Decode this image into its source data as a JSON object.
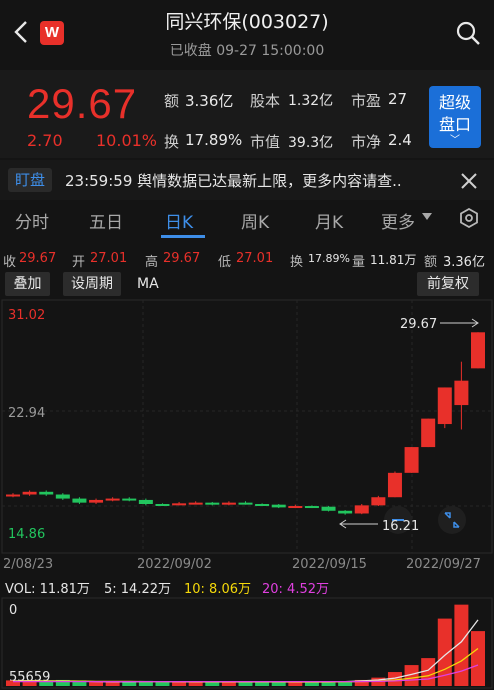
{
  "header": {
    "title": "同兴环保(003027)",
    "subtitle": "已收盘 09-27 15:00:00",
    "logo_text": "W"
  },
  "quote": {
    "price": "29.67",
    "change": "2.70",
    "change_pct": "10.01%",
    "amount_label": "额",
    "amount": "3.36亿",
    "equity_label": "股本",
    "equity": "1.32亿",
    "pe_label": "市盈",
    "pe": "27",
    "turnover_label": "换",
    "turnover": "17.89%",
    "mktcap_label": "市值",
    "mktcap": "39.3亿",
    "pb_label": "市净",
    "pb": "2.4",
    "super_btn_line1": "超级",
    "super_btn_line2": "盘口"
  },
  "alert": {
    "badge": "盯盘",
    "text": "23:59:59 舆情数据已达最新上限，更多内容请查.."
  },
  "tabs": [
    "分时",
    "五日",
    "日K",
    "周K",
    "月K",
    "更多"
  ],
  "active_tab": "日K",
  "ohlc": {
    "close_label": "收",
    "close": "29.67",
    "open_label": "开",
    "open": "27.01",
    "high_label": "高",
    "high": "29.67",
    "low_label": "低",
    "low": "27.01",
    "turnover_label": "换",
    "turnover": "17.89%",
    "volume_label": "量",
    "volume": "11.81万",
    "amount_label": "额",
    "amount": "3.36亿"
  },
  "controls": {
    "overlay": "叠加",
    "period": "设周期",
    "ma": "MA",
    "adjust": "前复权"
  },
  "colors": {
    "up": "#e8302a",
    "down": "#22c55e",
    "accent": "#3e8ee8",
    "ma10": "#f5d90a",
    "ma20": "#e040e0"
  },
  "chart_data": {
    "type": "candlestick",
    "price_axis": {
      "top_label": "31.02",
      "mid_label": "22.94",
      "bottom_label": "14.86",
      "ylim": [
        14.86,
        31.02
      ]
    },
    "x_labels": [
      "2/08/23",
      "2022/09/02",
      "2022/09/15",
      "2022/09/27"
    ],
    "annotations": {
      "max": "29.67",
      "min": "16.21"
    },
    "candles": [
      {
        "o": 17.6,
        "c": 17.7,
        "h": 17.8,
        "l": 17.5
      },
      {
        "o": 17.7,
        "c": 17.9,
        "h": 18.0,
        "l": 17.6
      },
      {
        "o": 17.9,
        "c": 17.7,
        "h": 18.0,
        "l": 17.6
      },
      {
        "o": 17.7,
        "c": 17.4,
        "h": 17.8,
        "l": 17.3
      },
      {
        "o": 17.4,
        "c": 17.1,
        "h": 17.5,
        "l": 17.0
      },
      {
        "o": 17.1,
        "c": 17.3,
        "h": 17.4,
        "l": 17.0
      },
      {
        "o": 17.3,
        "c": 17.4,
        "h": 17.5,
        "l": 17.2
      },
      {
        "o": 17.4,
        "c": 17.3,
        "h": 17.5,
        "l": 17.2
      },
      {
        "o": 17.3,
        "c": 17.0,
        "h": 17.4,
        "l": 16.9
      },
      {
        "o": 17.0,
        "c": 16.95,
        "h": 17.05,
        "l": 16.9
      },
      {
        "o": 16.95,
        "c": 17.05,
        "h": 17.15,
        "l": 16.9
      },
      {
        "o": 17.05,
        "c": 17.1,
        "h": 17.2,
        "l": 17.0
      },
      {
        "o": 17.1,
        "c": 16.95,
        "h": 17.15,
        "l": 16.9
      },
      {
        "o": 16.95,
        "c": 17.1,
        "h": 17.2,
        "l": 16.9
      },
      {
        "o": 17.1,
        "c": 17.0,
        "h": 17.2,
        "l": 16.95
      },
      {
        "o": 17.0,
        "c": 16.95,
        "h": 17.05,
        "l": 16.9
      },
      {
        "o": 16.95,
        "c": 16.75,
        "h": 17.0,
        "l": 16.7
      },
      {
        "o": 16.75,
        "c": 16.85,
        "h": 16.95,
        "l": 16.7
      },
      {
        "o": 16.85,
        "c": 16.75,
        "h": 16.9,
        "l": 16.7
      },
      {
        "o": 16.8,
        "c": 16.5,
        "h": 16.85,
        "l": 16.45
      },
      {
        "o": 16.5,
        "c": 16.3,
        "h": 16.55,
        "l": 16.21
      },
      {
        "o": 16.3,
        "c": 16.9,
        "h": 17.0,
        "l": 16.25
      },
      {
        "o": 16.9,
        "c": 17.5,
        "h": 17.6,
        "l": 16.85
      },
      {
        "o": 17.5,
        "c": 19.3,
        "h": 19.4,
        "l": 17.5
      },
      {
        "o": 19.3,
        "c": 21.2,
        "h": 21.2,
        "l": 19.3
      },
      {
        "o": 21.2,
        "c": 23.3,
        "h": 23.3,
        "l": 21.2
      },
      {
        "o": 22.9,
        "c": 25.6,
        "h": 25.6,
        "l": 22.6
      },
      {
        "o": 24.3,
        "c": 26.1,
        "h": 27.5,
        "l": 22.5
      },
      {
        "o": 27.01,
        "c": 29.67,
        "h": 29.67,
        "l": 27.01
      }
    ],
    "volume": {
      "label": "VOL: 11.81万",
      "ma5": "5: 14.22万",
      "ma10": "10: 8.06万",
      "ma20": "20: 4.52万",
      "top_label": "0",
      "bottom_label": "55659",
      "bars": [
        1.2,
        1.1,
        1.0,
        1.3,
        1.2,
        1.0,
        0.9,
        0.9,
        1.1,
        0.8,
        0.9,
        0.8,
        0.9,
        0.8,
        0.9,
        0.8,
        1.0,
        0.8,
        0.8,
        1.0,
        1.0,
        1.3,
        1.8,
        3.0,
        4.5,
        6.0,
        14.5,
        17.5,
        11.81
      ],
      "ma5_line": [
        1.1,
        1.15,
        1.1,
        1.1,
        1.05,
        0.95,
        0.9,
        0.9,
        0.95,
        0.95,
        0.9,
        0.85,
        0.85,
        0.85,
        0.85,
        0.85,
        0.85,
        0.85,
        0.85,
        0.85,
        0.95,
        1.1,
        1.3,
        1.7,
        2.5,
        3.4,
        6.6,
        9.5,
        14.22
      ],
      "ma10_line": [
        1.0,
        1.05,
        1.05,
        1.05,
        1.05,
        1.0,
        1.0,
        1.0,
        0.95,
        0.95,
        0.95,
        0.9,
        0.9,
        0.9,
        0.9,
        0.9,
        0.9,
        0.85,
        0.85,
        0.85,
        0.9,
        0.95,
        1.05,
        1.3,
        1.7,
        2.2,
        3.6,
        5.4,
        8.06
      ],
      "ma20_line": [
        0.95,
        0.95,
        0.95,
        0.95,
        0.95,
        0.95,
        0.95,
        0.95,
        0.95,
        0.95,
        0.95,
        0.95,
        0.95,
        0.95,
        0.95,
        0.95,
        0.95,
        0.95,
        0.95,
        0.95,
        0.95,
        0.95,
        1.0,
        1.1,
        1.3,
        1.5,
        2.3,
        3.2,
        4.52
      ]
    }
  }
}
